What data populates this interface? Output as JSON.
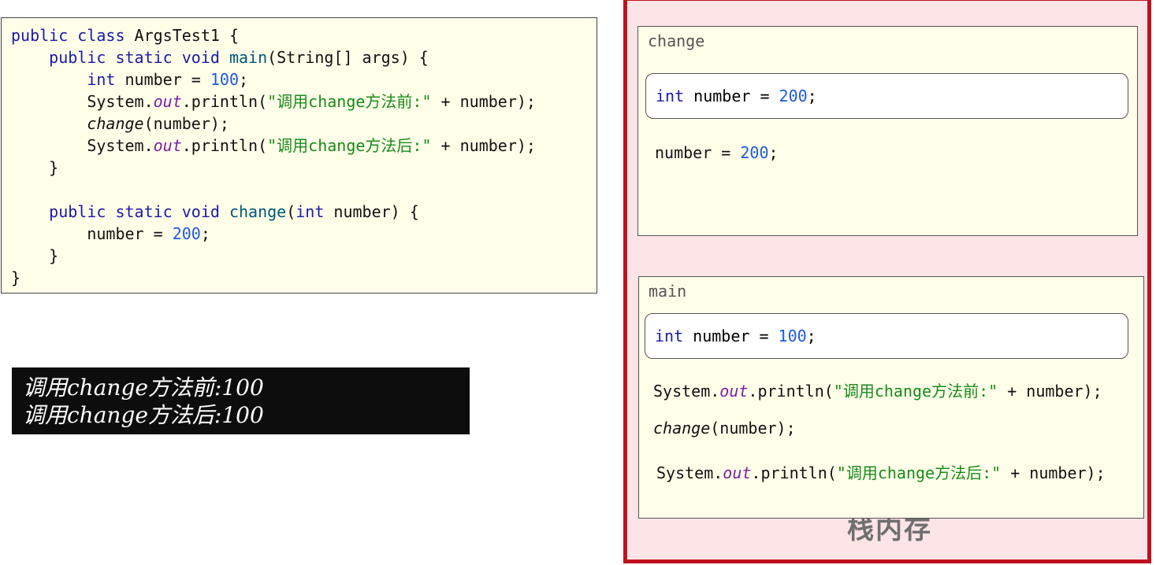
{
  "code": {
    "class_line": {
      "kw": "public class",
      "rest": " ArgsTest1 {"
    },
    "main_sig": {
      "kw": "public static void",
      "name": "main",
      "rest": "(String[] args) {"
    },
    "main_int": {
      "kw": "int",
      "rest": " number = ",
      "num": "100",
      "end": ";"
    },
    "print_before": {
      "obj": "System.",
      "field": "out",
      "call": ".println(",
      "str": "\"调用change方法前:\"",
      "end": " + number);"
    },
    "call_change": {
      "name": "change",
      "rest": "(number);"
    },
    "print_after": {
      "obj": "System.",
      "field": "out",
      "call": ".println(",
      "str": "\"调用change方法后:\"",
      "end": " + number);"
    },
    "close_brace": "}",
    "change_sig": {
      "kw": "public static void",
      "name": "change",
      "paren": "(",
      "kw2": "int",
      "rest": " number) {"
    },
    "assign": {
      "rest": "number = ",
      "num": "200",
      "end": ";"
    }
  },
  "console": {
    "lines": [
      "调用change方法前:100",
      "调用change方法后:100"
    ]
  },
  "stack": {
    "label": "栈内存",
    "change_frame": {
      "title": "change",
      "var": {
        "kw": "int",
        "rest": " number = ",
        "num": "200",
        "end": ";"
      },
      "stmt": {
        "rest": "number = ",
        "num": "200",
        "end": ";"
      }
    },
    "main_frame": {
      "title": "main",
      "var": {
        "kw": "int",
        "rest": " number = ",
        "num": "100",
        "end": ";"
      },
      "print_before": {
        "obj": "System.",
        "field": "out",
        "call": ".println(",
        "str": "\"调用change方法前:\"",
        "end": " + number);"
      },
      "call_change": {
        "name": "change",
        "rest": "(number);"
      },
      "print_after": {
        "obj": "System.",
        "field": "out",
        "call": ".println(",
        "str": "\"调用change方法后:\"",
        "end": " + number);"
      }
    }
  }
}
